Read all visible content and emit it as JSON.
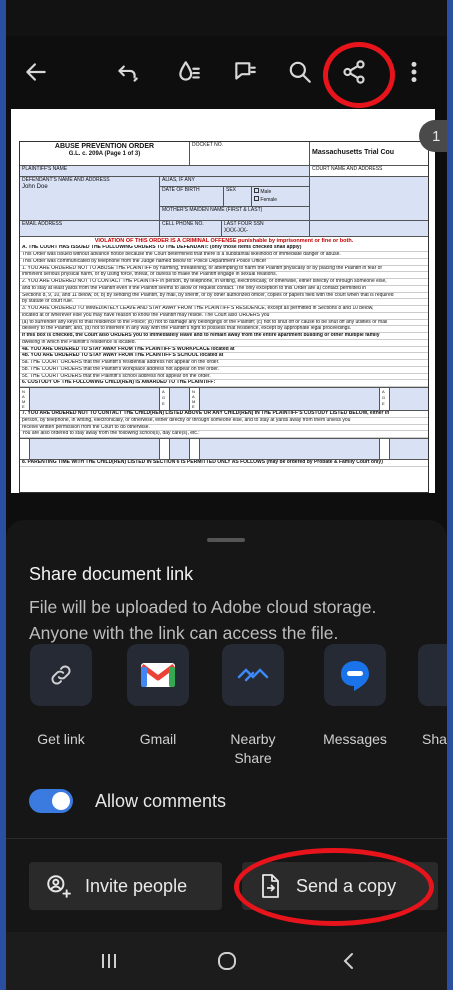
{
  "toolbar": {
    "icons": [
      "back-arrow-icon",
      "undo-icon",
      "color-drop-icon",
      "comment-icon",
      "search-icon",
      "share-icon",
      "more-vert-icon"
    ]
  },
  "document": {
    "page_indicator": "1",
    "form": {
      "title": "ABUSE PREVENTION ORDER",
      "subtitle": "G.L. c. 209A (Page 1 of 3)",
      "docket": "DOCKET NO.",
      "court": "Massachusetts Trial Cou",
      "court_name_label": "COURT NAME AND ADDRESS",
      "plaintiff_label": "PLAINTIFF'S NAME",
      "defendant_label": "DEFENDANT'S NAME AND ADDRESS",
      "alias_label": "ALIAS, IF ANY",
      "defendant_name": "John Doe",
      "dob_label": "DATE OF BIRTH",
      "sex_label": "SEX",
      "male": "Male",
      "female": "Female",
      "mother_label": "MOTHER'S MAIDEN NAME (FIRST & LAST)",
      "email_label": "EMAIL ADDRESS",
      "cell_label": "CELL PHONE NO.",
      "ssn_label": "LAST FOUR SSN",
      "ssn_value": "XXX-XX-",
      "violation": "VIOLATION OF THIS ORDER IS A CRIMINAL OFFENSE punishable by imprisonment or fine or both.",
      "lines": [
        "A. THE COURT HAS ISSUED THE FOLLOWING ORDERS TO THE DEFENDANT: (only those items checked shall apply)",
        "This Order was issued without advance notice because the Court determined that there is a substantial likelihood of immediate danger of abuse.",
        "This Order was communicated by telephone from the Judge named below to: Police Department Police Officer",
        "1. YOU ARE ORDERED NOT TO ABUSE THE PLAINTIFF by harming, threatening, or attempting to harm the Plaintiff physically or by placing the Plaintiff in fear of",
        "imminent serious physical harm, or by using force, threat, or duress to make the Plaintiff engage in sexual relations.",
        "2. YOU ARE ORDERED NOT TO CONTACT THE PLAINTIFF in person, by telephone, in writing, electronically, or otherwise, either directly or through someone else,",
        "and to stay at least yards from the Plaintiff even if the Plaintiff seems to allow or request contact. The only exception to this Order are a) contact permitted in",
        "Sections 8, 9, 10, and 11 below, or, b) by sending the Plaintiff, by mail, by sheriff, or by other authorized officer, copies of papers filed with the court when that is required",
        "by statute or court rule.",
        "3. YOU ARE ORDERED TO IMMEDIATELY LEAVE AND STAY AWAY FROM THE PLAINTIFF'S RESIDENCE, except as permitted in Sections 8 and 10 below,",
        "located at or wherever else you may have reason to know the Plaintiff may reside. The Court also ORDERS you",
        "(a) to surrender any keys to that residence to the Police; (b) not to damage any belongings of the Plaintiff; (c) not to shut off or cause to be shut off any utilities or mail",
        "delivery to the Plaintiff; and, (d) not to interfere in any way with the Plaintiff's right to possess that residence, except by appropriate legal proceedings.",
        "If this box is checked, the Court also ORDERS you to immediately leave and to remain away from the entire apartment building or other multiple family",
        "dwelling in which the Plaintiff's residence is located.",
        "4a. YOU ARE ORDERED TO STAY AWAY FROM THE PLAINTIFF'S WORKPLACE located at",
        "4b. YOU ARE ORDERED TO STAY AWAY FROM THE PLAINTIFF'S SCHOOL located at",
        "5a. THE COURT ORDERS that the Plaintiff's residential address not appear on the order.",
        "5b. THE COURT ORDERS that the Plaintiff's workplace address not appear on the order.",
        "5c. THE COURT ORDERS that the Plaintiff's school address not appear on the order.",
        "6. CUSTODY OF THE FOLLOWING CHILD(REN) IS AWARDED TO THE PLAINTIFF:"
      ],
      "lines2": [
        "7. YOU ARE ORDERED NOT TO CONTACT THE CHILD(REN) LISTED ABOVE OR ANY CHILD(REN) IN THE PLAINTIFF'S CUSTODY LISTED BELOW, either in",
        "person, by telephone, in writing, electronically, or otherwise, either directly or through someone else, and to stay at yards away from them unless you",
        "receive written permission from the Court to do otherwise.",
        "You are also ordered to stay away from the following school(s), day care(s), etc.:"
      ],
      "last_line": "8. PARENTING TIME WITH THE CHILD(REN) LISTED IN SECTION 6 IS PERMITTED ONLY AS FOLLOWS (may be ordered by Probate & Family Court only)",
      "name_letters": [
        "N",
        "A",
        "M",
        "E"
      ],
      "age_letters": [
        "A",
        "G",
        "E"
      ]
    }
  },
  "share_sheet": {
    "title": "Share document link",
    "description": "File will be uploaded to Adobe cloud storage. Anyone with the link can access the file.",
    "targets": [
      {
        "label": "Get link",
        "icon": "link-icon"
      },
      {
        "label": "Gmail",
        "icon": "gmail-icon"
      },
      {
        "label": "Nearby Share",
        "icon": "nearby-share-icon"
      },
      {
        "label": "Messages",
        "icon": "messages-icon"
      },
      {
        "label": "Sha",
        "icon": "share-more-icon"
      }
    ],
    "allow_comments": {
      "label": "Allow comments",
      "enabled": true
    },
    "invite_label": "Invite people",
    "send_copy_label": "Send a copy"
  },
  "navigation": {
    "icons": [
      "recent-apps-icon",
      "home-icon",
      "back-icon"
    ]
  },
  "colors": {
    "highlight_circle": "#e8141b",
    "toggle_on": "#3b7be0",
    "frame_border": "#2a4fa0"
  }
}
